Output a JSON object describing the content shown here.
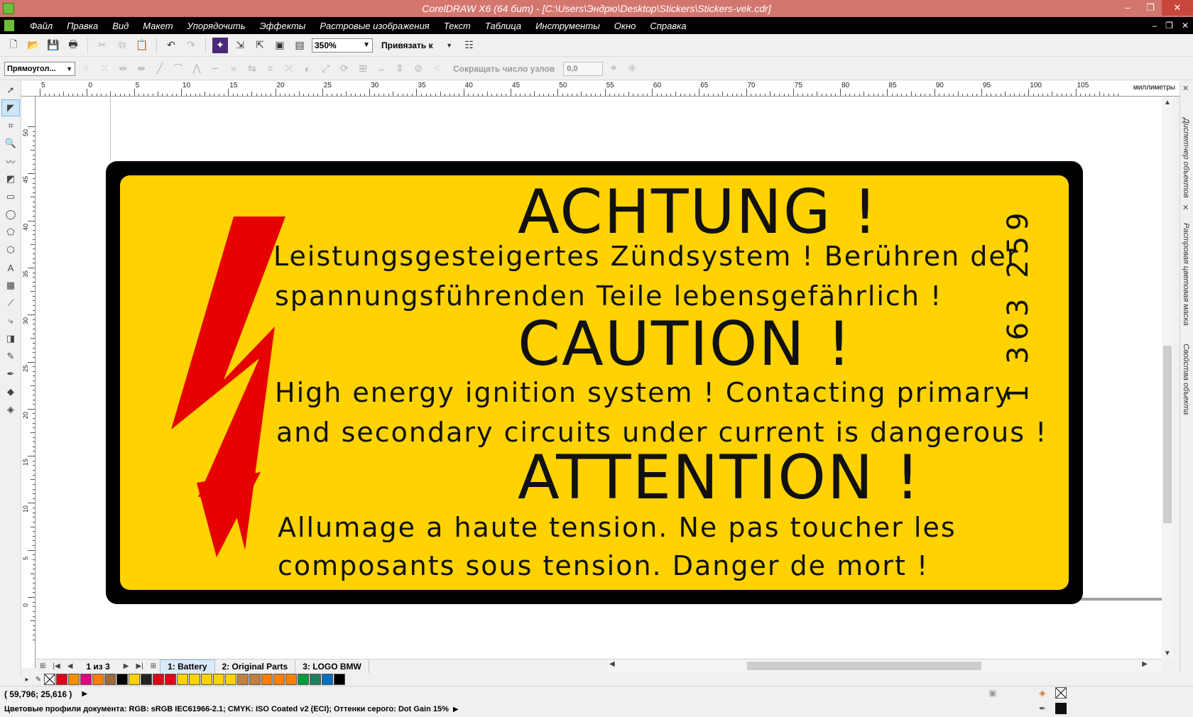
{
  "window": {
    "title": "CorelDRAW X6 (64 бит) - [C:\\Users\\Эндрю\\Desktop\\Stickers\\Stickers-vek.cdr]",
    "controls": [
      "‒",
      "❐",
      "✕"
    ]
  },
  "menu": {
    "items": [
      "Файл",
      "Правка",
      "Вид",
      "Макет",
      "Упорядочить",
      "Эффекты",
      "Растровые изображения",
      "Текст",
      "Таблица",
      "Инструменты",
      "Окно",
      "Справка"
    ],
    "doc_controls": [
      "‒",
      "❐",
      "✕"
    ]
  },
  "toolbar": {
    "zoom_value": "350%",
    "snap_label": "Привязать к"
  },
  "property_bar": {
    "shape_type": "Прямоугол...",
    "reduce_nodes_label": "Сокращать число узлов",
    "reduce_nodes_value": "0,0"
  },
  "ruler": {
    "h_ticks": [
      "5",
      "0",
      "5",
      "10",
      "15",
      "20",
      "25",
      "30",
      "35",
      "40",
      "45",
      "50",
      "55",
      "60",
      "65",
      "70",
      "75",
      "80",
      "85",
      "90",
      "95",
      "100",
      "105"
    ],
    "v_ticks": [
      "50",
      "45",
      "40",
      "35",
      "30",
      "25",
      "20",
      "15",
      "10",
      "5",
      "0"
    ],
    "units": "миллиметры"
  },
  "sticker": {
    "heading_de": "ACHTUNG !",
    "text_de_1": "Leistungsgesteigertes Zündsystem !  Berühren der",
    "text_de_2": "spannungsführenden Teile lebensgefährlich !",
    "heading_en": "CAUTION !",
    "text_en_1": "High energy ignition system ! Contacting primary",
    "text_en_2": "and secondary circuits under current is dangerous !",
    "heading_fr": "ATTENTION !",
    "text_fr_1": "Allumage a haute tension. Ne pas toucher  les",
    "text_fr_2": "composants  sous tension. Danger de  mort !",
    "part_number": "1 363 259",
    "colors": {
      "background": "#ffd200",
      "border": "#000000",
      "bolt": "#e60000"
    }
  },
  "dockers": {
    "tab1": "Диспетчер объектов",
    "tab2": "Растровая цветовая маска",
    "tab3": "Свойства объекта"
  },
  "pages": {
    "info": "1 из 3",
    "tabs": [
      "1: Battery",
      "2: Original Parts",
      "3: LOGO BMW"
    ]
  },
  "palette": [
    "#e2001a",
    "#f29100",
    "#e5007e",
    "#ff8000",
    "#9a6b3f",
    "#000000",
    "#ffd200",
    "#222222",
    "#e2001a",
    "#e2001a",
    "#ffd200",
    "#ffd200",
    "#ffd200",
    "#ffd200",
    "#ffd200",
    "#c0803f",
    "#c0803f",
    "#ff8000",
    "#ff8000",
    "#ff8000",
    "#009a3e",
    "#1d7f5f",
    "#0070c0",
    "#000000"
  ],
  "status": {
    "coords": "( 59,796; 25,616 )",
    "color_profiles": "Цветовые профили документа: RGB: sRGB IEC61966-2.1; CMYK: ISO Coated v2 (ECI); Оттенки серого: Dot Gain 15%"
  }
}
